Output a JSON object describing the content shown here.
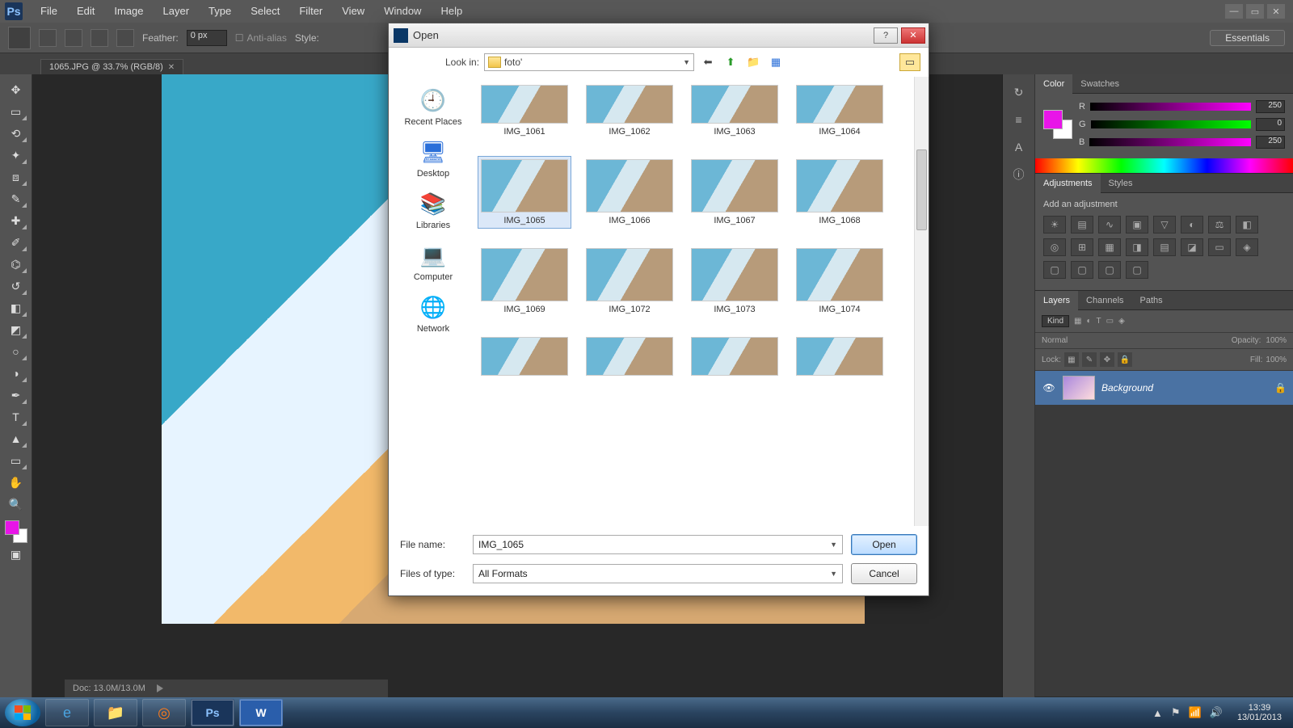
{
  "menubar": {
    "items": [
      "File",
      "Edit",
      "Image",
      "Layer",
      "Type",
      "Select",
      "Filter",
      "View",
      "Window",
      "Help"
    ]
  },
  "options": {
    "feather_label": "Feather:",
    "feather_value": "0 px",
    "anti_alias": "Anti-alias",
    "style_label": "Style:",
    "workspace": "Essentials"
  },
  "doc_tab": {
    "label": "1065.JPG @ 33.7% (RGB/8)"
  },
  "status": {
    "doc": "Doc: 13.0M/13.0M"
  },
  "panels": {
    "color": {
      "tab1": "Color",
      "tab2": "Swatches",
      "r_label": "R",
      "g_label": "G",
      "b_label": "B",
      "r": "250",
      "g": "0",
      "b": "250"
    },
    "adjustments": {
      "tab1": "Adjustments",
      "tab2": "Styles",
      "hint": "Add an adjustment"
    },
    "layers": {
      "tab1": "Layers",
      "tab2": "Channels",
      "tab3": "Paths",
      "kind": "Kind",
      "blend": "Normal",
      "opacity_label": "Opacity:",
      "opacity": "100%",
      "lock_label": "Lock:",
      "fill_label": "Fill:",
      "fill": "100%",
      "bg_layer": "Background"
    }
  },
  "dialog": {
    "title": "Open",
    "lookin_label": "Look in:",
    "lookin_value": "foto'",
    "places": [
      "Recent Places",
      "Desktop",
      "Libraries",
      "Computer",
      "Network"
    ],
    "files_row0": [
      "IMG_1061",
      "IMG_1062",
      "IMG_1063",
      "IMG_1064"
    ],
    "files_row1": [
      "IMG_1065",
      "IMG_1066",
      "IMG_1067",
      "IMG_1068"
    ],
    "files_row2": [
      "IMG_1069",
      "IMG_1072",
      "IMG_1073",
      "IMG_1074"
    ],
    "selected": "IMG_1065",
    "filename_label": "File name:",
    "filename_value": "IMG_1065",
    "filetype_label": "Files of type:",
    "filetype_value": "All Formats",
    "open": "Open",
    "cancel": "Cancel"
  },
  "taskbar": {
    "time": "13:39",
    "date": "13/01/2013"
  }
}
